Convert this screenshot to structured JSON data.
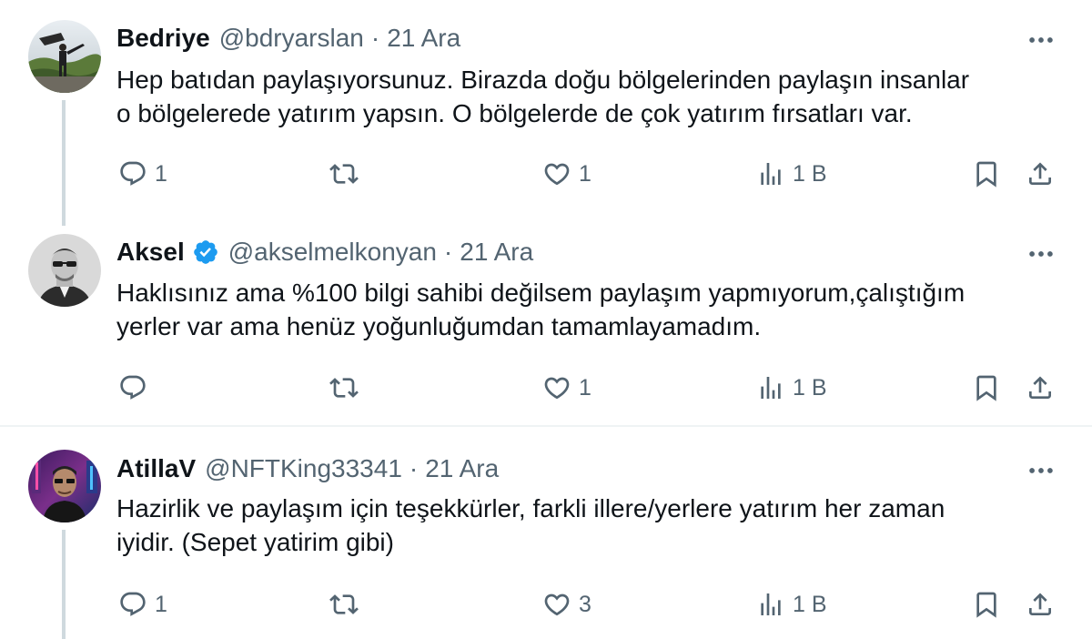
{
  "tweets": [
    {
      "name": "Bedriye",
      "handle": "@bdryarslan",
      "sep": "·",
      "date": "21 Ara",
      "verified": false,
      "text_lines": [
        "Hep batıdan paylaşıyorsunuz. Birazda doğu bölgelerinden paylaşın insanlar",
        "o bölgelerede yatırım yapsın. O bölgelerde de çok yatırım fırsatları var."
      ],
      "replies": "1",
      "retweets": "",
      "likes": "1",
      "views": "1 B"
    },
    {
      "name": "Aksel",
      "handle": "@akselmelkonyan",
      "sep": "·",
      "date": "21 Ara",
      "verified": true,
      "text_lines": [
        "Haklısınız ama %100 bilgi sahibi değilsem paylaşım yapmıyorum,çalıştığım",
        "yerler var ama henüz yoğunluğumdan tamamlayamadım."
      ],
      "replies": "",
      "retweets": "",
      "likes": "1",
      "views": "1 B"
    },
    {
      "name": "AtillaV",
      "handle": "@NFTKing33341",
      "sep": "·",
      "date": "21 Ara",
      "verified": false,
      "text_lines": [
        "Hazirlik ve paylaşım için teşekkürler, farkli illere/yerlere yatırım her zaman",
        "iyidir. (Sepet yatirim gibi)"
      ],
      "replies": "1",
      "retweets": "",
      "likes": "3",
      "views": "1 B"
    }
  ],
  "colors": {
    "text": "#0f1419",
    "muted": "#536471",
    "thread_line": "#cfd9de",
    "divider": "#eff3f4",
    "verified": "#1d9bf0"
  },
  "icons": {
    "reply": "reply-icon",
    "retweet": "retweet-icon",
    "like": "heart-icon",
    "views": "views-chart-icon",
    "bookmark": "bookmark-icon",
    "share": "share-icon",
    "more": "more-dots-icon",
    "verified": "verified-badge-icon"
  }
}
